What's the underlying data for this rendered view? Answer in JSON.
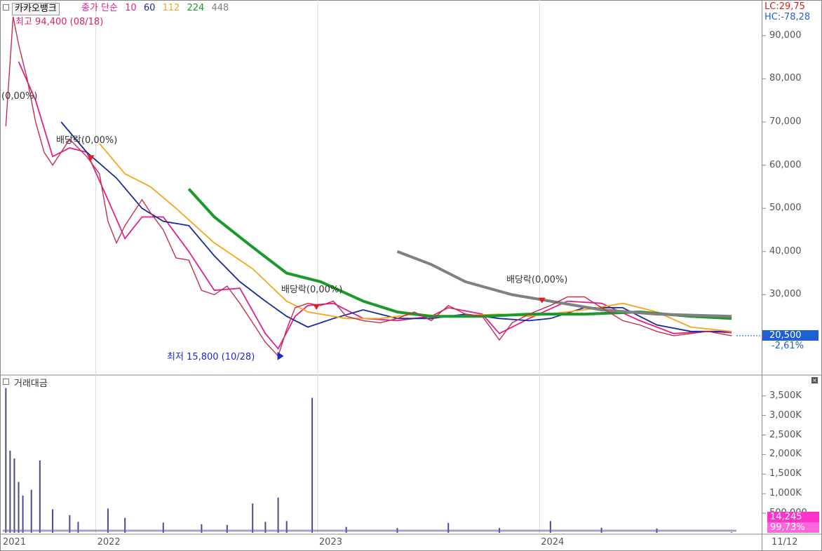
{
  "header": {
    "stock_name": "카카오뱅크",
    "legend_prefix": "종가 단순",
    "ma_periods": [
      "10",
      "60",
      "112",
      "224",
      "448"
    ],
    "ma_colors": [
      "#e0208c",
      "#1a2a9a",
      "#f2a818",
      "#1a9a2a",
      "#808080"
    ],
    "lc": "LC:29,75",
    "hc": "HC:-78,28"
  },
  "price_pane": {
    "high_label": "최고 94,400 (08/18)",
    "low_label": "최저 15,800 (10/28)",
    "dividend_labels": [
      "(0,00%)",
      "배당락(0,00%)",
      "배당락(0,00%)",
      "배당락(0,00%)"
    ],
    "current_price": "20,500",
    "change_pct": "-2,61%",
    "y_ticks": [
      "90,000",
      "80,000",
      "70,000",
      "60,000",
      "50,000",
      "40,000",
      "30,000",
      "20,000"
    ]
  },
  "volume_pane": {
    "title": "거래대금",
    "y_ticks": [
      "3,500K",
      "3,000K",
      "2,500K",
      "2,000K",
      "1,500K",
      "1,000K",
      "500,000"
    ],
    "current_value": "14,245",
    "current_pct": "99,73%"
  },
  "x_axis": {
    "labels": [
      "2021",
      "2022",
      "2023",
      "2024"
    ],
    "end_label": "11/12"
  },
  "chart_data": {
    "type": "line",
    "title": "카카오뱅크",
    "x_unit": "date (weekly, 2021-08 to 2024-11)",
    "ylim": [
      13000,
      98000
    ],
    "close": [
      {
        "x": "2021-08-06",
        "y": 69000
      },
      {
        "x": "2021-08-18",
        "y": 94400
      },
      {
        "x": "2021-08-27",
        "y": 88000
      },
      {
        "x": "2021-09-10",
        "y": 80000
      },
      {
        "x": "2021-09-24",
        "y": 70000
      },
      {
        "x": "2021-10-08",
        "y": 63000
      },
      {
        "x": "2021-10-22",
        "y": 60000
      },
      {
        "x": "2021-11-05",
        "y": 63000
      },
      {
        "x": "2021-11-19",
        "y": 66000
      },
      {
        "x": "2021-12-03",
        "y": 64000
      },
      {
        "x": "2021-12-17",
        "y": 62000
      },
      {
        "x": "2022-01-07",
        "y": 58000
      },
      {
        "x": "2022-01-21",
        "y": 47000
      },
      {
        "x": "2022-02-04",
        "y": 42000
      },
      {
        "x": "2022-02-18",
        "y": 46000
      },
      {
        "x": "2022-03-04",
        "y": 49000
      },
      {
        "x": "2022-03-18",
        "y": 52000
      },
      {
        "x": "2022-04-01",
        "y": 49000
      },
      {
        "x": "2022-04-22",
        "y": 45000
      },
      {
        "x": "2022-05-13",
        "y": 38500
      },
      {
        "x": "2022-06-03",
        "y": 38000
      },
      {
        "x": "2022-06-24",
        "y": 31000
      },
      {
        "x": "2022-07-15",
        "y": 30000
      },
      {
        "x": "2022-08-05",
        "y": 32000
      },
      {
        "x": "2022-08-26",
        "y": 28000
      },
      {
        "x": "2022-09-16",
        "y": 23500
      },
      {
        "x": "2022-10-07",
        "y": 19000
      },
      {
        "x": "2022-10-28",
        "y": 15800
      },
      {
        "x": "2022-11-11",
        "y": 22000
      },
      {
        "x": "2022-11-25",
        "y": 27000
      },
      {
        "x": "2022-12-16",
        "y": 28000
      },
      {
        "x": "2023-01-06",
        "y": 27500
      },
      {
        "x": "2023-01-27",
        "y": 28500
      },
      {
        "x": "2023-02-17",
        "y": 25000
      },
      {
        "x": "2023-03-17",
        "y": 24000
      },
      {
        "x": "2023-04-14",
        "y": 23500
      },
      {
        "x": "2023-05-12",
        "y": 24500
      },
      {
        "x": "2023-06-09",
        "y": 26000
      },
      {
        "x": "2023-07-07",
        "y": 24000
      },
      {
        "x": "2023-08-04",
        "y": 27500
      },
      {
        "x": "2023-09-01",
        "y": 25500
      },
      {
        "x": "2023-09-29",
        "y": 25000
      },
      {
        "x": "2023-10-27",
        "y": 19500
      },
      {
        "x": "2023-11-17",
        "y": 23500
      },
      {
        "x": "2023-12-15",
        "y": 25500
      },
      {
        "x": "2024-01-19",
        "y": 27500
      },
      {
        "x": "2024-02-16",
        "y": 29500
      },
      {
        "x": "2024-03-15",
        "y": 29500
      },
      {
        "x": "2024-04-12",
        "y": 27000
      },
      {
        "x": "2024-05-17",
        "y": 24000
      },
      {
        "x": "2024-06-14",
        "y": 23000
      },
      {
        "x": "2024-07-12",
        "y": 21500
      },
      {
        "x": "2024-08-09",
        "y": 20500
      },
      {
        "x": "2024-09-06",
        "y": 21000
      },
      {
        "x": "2024-10-04",
        "y": 21500
      },
      {
        "x": "2024-11-12",
        "y": 20500
      }
    ],
    "series": [
      {
        "name": "10",
        "color": "#e0208c",
        "points": [
          {
            "x": "2021-08-27",
            "y": 84000
          },
          {
            "x": "2021-09-24",
            "y": 75000
          },
          {
            "x": "2021-10-22",
            "y": 62000
          },
          {
            "x": "2021-11-19",
            "y": 64000
          },
          {
            "x": "2021-12-17",
            "y": 63000
          },
          {
            "x": "2022-01-21",
            "y": 52000
          },
          {
            "x": "2022-02-18",
            "y": 43000
          },
          {
            "x": "2022-03-18",
            "y": 48000
          },
          {
            "x": "2022-04-22",
            "y": 48000
          },
          {
            "x": "2022-06-03",
            "y": 40000
          },
          {
            "x": "2022-07-15",
            "y": 31000
          },
          {
            "x": "2022-08-26",
            "y": 31500
          },
          {
            "x": "2022-10-07",
            "y": 21000
          },
          {
            "x": "2022-10-28",
            "y": 17500
          },
          {
            "x": "2022-11-25",
            "y": 25000
          },
          {
            "x": "2022-12-16",
            "y": 27500
          },
          {
            "x": "2023-01-27",
            "y": 28000
          },
          {
            "x": "2023-03-17",
            "y": 24500
          },
          {
            "x": "2023-05-12",
            "y": 24000
          },
          {
            "x": "2023-07-07",
            "y": 25000
          },
          {
            "x": "2023-08-04",
            "y": 27000
          },
          {
            "x": "2023-09-29",
            "y": 25500
          },
          {
            "x": "2023-10-27",
            "y": 21000
          },
          {
            "x": "2023-12-15",
            "y": 24500
          },
          {
            "x": "2024-02-16",
            "y": 28500
          },
          {
            "x": "2024-04-12",
            "y": 28000
          },
          {
            "x": "2024-06-14",
            "y": 24000
          },
          {
            "x": "2024-08-09",
            "y": 21000
          },
          {
            "x": "2024-10-04",
            "y": 21500
          },
          {
            "x": "2024-11-12",
            "y": 21200
          }
        ]
      },
      {
        "name": "60",
        "color": "#1a2a9a",
        "points": [
          {
            "x": "2021-11-05",
            "y": 70000
          },
          {
            "x": "2021-12-17",
            "y": 63000
          },
          {
            "x": "2022-02-04",
            "y": 57000
          },
          {
            "x": "2022-03-18",
            "y": 50000
          },
          {
            "x": "2022-04-22",
            "y": 47000
          },
          {
            "x": "2022-06-03",
            "y": 46000
          },
          {
            "x": "2022-07-15",
            "y": 39000
          },
          {
            "x": "2022-08-26",
            "y": 33000
          },
          {
            "x": "2022-10-07",
            "y": 28500
          },
          {
            "x": "2022-11-11",
            "y": 25000
          },
          {
            "x": "2022-12-16",
            "y": 22500
          },
          {
            "x": "2023-01-27",
            "y": 24500
          },
          {
            "x": "2023-03-17",
            "y": 26500
          },
          {
            "x": "2023-05-12",
            "y": 24500
          },
          {
            "x": "2023-07-07",
            "y": 24500
          },
          {
            "x": "2023-09-01",
            "y": 25500
          },
          {
            "x": "2023-10-27",
            "y": 24500
          },
          {
            "x": "2023-12-15",
            "y": 24000
          },
          {
            "x": "2024-01-19",
            "y": 24500
          },
          {
            "x": "2024-03-15",
            "y": 27000
          },
          {
            "x": "2024-05-17",
            "y": 27000
          },
          {
            "x": "2024-07-12",
            "y": 23000
          },
          {
            "x": "2024-09-06",
            "y": 21500
          },
          {
            "x": "2024-11-12",
            "y": 21500
          }
        ]
      },
      {
        "name": "112",
        "color": "#f2a818",
        "points": [
          {
            "x": "2022-01-07",
            "y": 65000
          },
          {
            "x": "2022-02-18",
            "y": 58000
          },
          {
            "x": "2022-04-01",
            "y": 55000
          },
          {
            "x": "2022-05-13",
            "y": 50000
          },
          {
            "x": "2022-07-15",
            "y": 42000
          },
          {
            "x": "2022-09-16",
            "y": 36000
          },
          {
            "x": "2022-11-11",
            "y": 28500
          },
          {
            "x": "2022-12-16",
            "y": 26000
          },
          {
            "x": "2023-02-17",
            "y": 24500
          },
          {
            "x": "2023-04-14",
            "y": 24500
          },
          {
            "x": "2023-06-09",
            "y": 25500
          },
          {
            "x": "2023-08-04",
            "y": 25000
          },
          {
            "x": "2023-10-27",
            "y": 25500
          },
          {
            "x": "2023-12-15",
            "y": 25000
          },
          {
            "x": "2024-03-15",
            "y": 26500
          },
          {
            "x": "2024-05-17",
            "y": 28000
          },
          {
            "x": "2024-07-12",
            "y": 26000
          },
          {
            "x": "2024-09-06",
            "y": 22500
          },
          {
            "x": "2024-11-12",
            "y": 21500
          }
        ]
      },
      {
        "name": "224",
        "color": "#1a9a2a",
        "points": [
          {
            "x": "2022-06-03",
            "y": 54500
          },
          {
            "x": "2022-07-15",
            "y": 48000
          },
          {
            "x": "2022-09-16",
            "y": 41000
          },
          {
            "x": "2022-11-11",
            "y": 35000
          },
          {
            "x": "2023-01-06",
            "y": 33000
          },
          {
            "x": "2023-03-17",
            "y": 28500
          },
          {
            "x": "2023-05-12",
            "y": 26000
          },
          {
            "x": "2023-07-07",
            "y": 25000
          },
          {
            "x": "2023-09-29",
            "y": 25000
          },
          {
            "x": "2023-12-15",
            "y": 25500
          },
          {
            "x": "2024-03-15",
            "y": 25500
          },
          {
            "x": "2024-06-14",
            "y": 26000
          },
          {
            "x": "2024-09-06",
            "y": 25000
          },
          {
            "x": "2024-11-12",
            "y": 24500
          }
        ]
      },
      {
        "name": "448",
        "color": "#808080",
        "points": [
          {
            "x": "2023-05-12",
            "y": 40000
          },
          {
            "x": "2023-07-07",
            "y": 37000
          },
          {
            "x": "2023-09-01",
            "y": 33000
          },
          {
            "x": "2023-11-17",
            "y": 30000
          },
          {
            "x": "2024-01-19",
            "y": 28500
          },
          {
            "x": "2024-04-12",
            "y": 26500
          },
          {
            "x": "2024-07-12",
            "y": 25500
          },
          {
            "x": "2024-11-12",
            "y": 25000
          }
        ]
      }
    ],
    "volume": {
      "name": "거래대금",
      "unit": "K",
      "ylim": [
        0,
        3800
      ],
      "bars": [
        {
          "x": "2021-08-06",
          "y": 3700
        },
        {
          "x": "2021-08-13",
          "y": 2100
        },
        {
          "x": "2021-08-20",
          "y": 1900
        },
        {
          "x": "2021-08-27",
          "y": 1300
        },
        {
          "x": "2021-09-03",
          "y": 950
        },
        {
          "x": "2021-09-17",
          "y": 1100
        },
        {
          "x": "2021-10-01",
          "y": 1850
        },
        {
          "x": "2021-10-22",
          "y": 600
        },
        {
          "x": "2021-11-19",
          "y": 450
        },
        {
          "x": "2021-12-03",
          "y": 280
        },
        {
          "x": "2022-01-21",
          "y": 620
        },
        {
          "x": "2022-02-18",
          "y": 380
        },
        {
          "x": "2022-04-22",
          "y": 260
        },
        {
          "x": "2022-06-24",
          "y": 220
        },
        {
          "x": "2022-08-05",
          "y": 200
        },
        {
          "x": "2022-09-16",
          "y": 750
        },
        {
          "x": "2022-10-07",
          "y": 280
        },
        {
          "x": "2022-10-28",
          "y": 900
        },
        {
          "x": "2022-11-11",
          "y": 300
        },
        {
          "x": "2022-12-23",
          "y": 3450
        },
        {
          "x": "2023-02-17",
          "y": 150
        },
        {
          "x": "2023-05-12",
          "y": 120
        },
        {
          "x": "2023-08-04",
          "y": 250
        },
        {
          "x": "2023-10-27",
          "y": 120
        },
        {
          "x": "2024-01-19",
          "y": 300
        },
        {
          "x": "2024-04-12",
          "y": 130
        },
        {
          "x": "2024-07-12",
          "y": 110
        },
        {
          "x": "2024-11-12",
          "y": 14
        }
      ]
    }
  }
}
